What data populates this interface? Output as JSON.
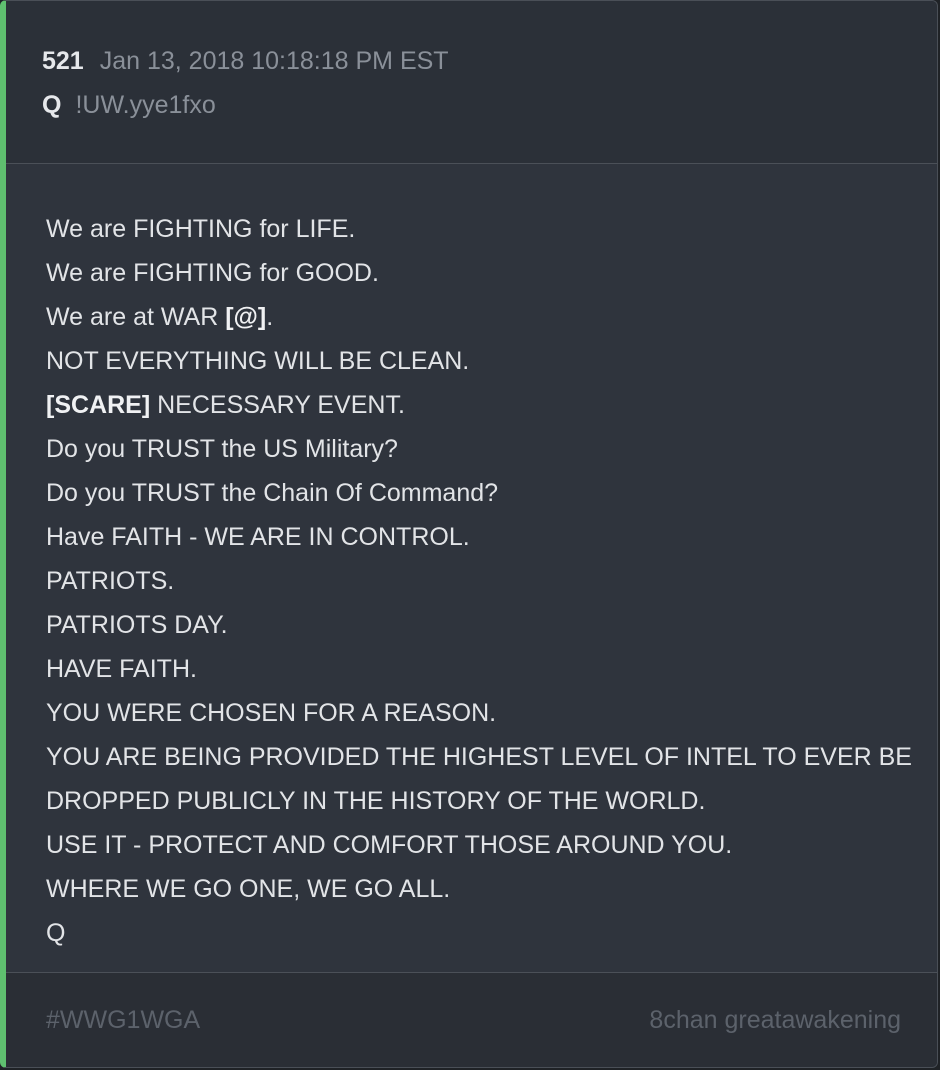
{
  "post": {
    "number": "521",
    "date": "Jan 13, 2018 10:18:18 PM EST",
    "author": "Q",
    "tripcode": "!UW.yye1fxo",
    "accent_color": "#5fbf6f",
    "lines": [
      {
        "pre": "We are FIGHTING for LIFE.",
        "bold": "",
        "post": ""
      },
      {
        "pre": "We are FIGHTING for GOOD.",
        "bold": "",
        "post": ""
      },
      {
        "pre": "We are at WAR ",
        "bold": "[@]",
        "post": "."
      },
      {
        "pre": "NOT EVERYTHING WILL BE CLEAN.",
        "bold": "",
        "post": ""
      },
      {
        "pre": "",
        "bold": "[SCARE]",
        "post": " NECESSARY EVENT."
      },
      {
        "pre": "Do you TRUST the US Military?",
        "bold": "",
        "post": ""
      },
      {
        "pre": "Do you TRUST the Chain Of Command?",
        "bold": "",
        "post": ""
      },
      {
        "pre": "Have FAITH - WE ARE IN CONTROL.",
        "bold": "",
        "post": ""
      },
      {
        "pre": "PATRIOTS.",
        "bold": "",
        "post": ""
      },
      {
        "pre": "PATRIOTS DAY.",
        "bold": "",
        "post": ""
      },
      {
        "pre": "HAVE FAITH.",
        "bold": "",
        "post": ""
      },
      {
        "pre": "YOU WERE CHOSEN FOR A REASON.",
        "bold": "",
        "post": ""
      },
      {
        "pre": "YOU ARE BEING PROVIDED THE HIGHEST LEVEL OF INTEL TO EVER BE",
        "bold": "",
        "post": ""
      },
      {
        "pre": "DROPPED PUBLICLY IN THE HISTORY OF THE WORLD.",
        "bold": "",
        "post": ""
      },
      {
        "pre": "USE IT - PROTECT AND COMFORT THOSE AROUND YOU.",
        "bold": "",
        "post": ""
      },
      {
        "pre": "WHERE WE GO ONE, WE GO ALL.",
        "bold": "",
        "post": ""
      },
      {
        "pre": "Q",
        "bold": "",
        "post": ""
      }
    ]
  },
  "footer": {
    "hashtag": "#WWG1WGA",
    "source": "8chan greatawakening"
  }
}
